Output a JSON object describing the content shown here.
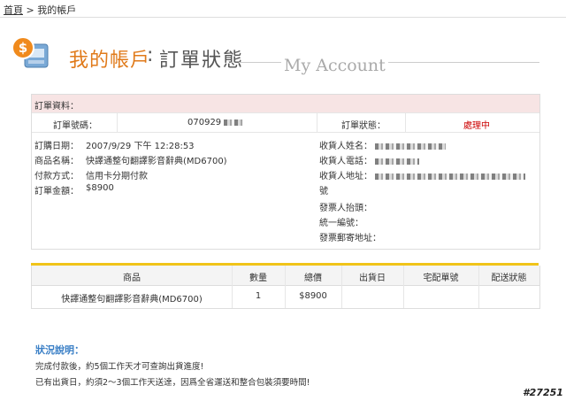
{
  "breadcrumb": {
    "home": "首頁",
    "sep": ">",
    "current": "我的帳戶"
  },
  "header": {
    "title": "我的帳戶",
    "colon": ":",
    "subtitle": "訂單狀態",
    "english": "My Account"
  },
  "order": {
    "section_title": "訂單資料：",
    "order_no_label": "訂單號碼：",
    "order_no_value": "070929",
    "status_label": "訂單狀態：",
    "status_value": "處理中",
    "date_label": "訂購日期：",
    "date_value": "2007/9/29 下午 12:28:53",
    "product_label": "商品名稱：",
    "product_value": "快譯通整句翻譯影音辭典(MD6700)",
    "payment_label": "付款方式：",
    "payment_value": "信用卡分期付款",
    "amount_label": "訂單金額：",
    "amount_value": "$8900",
    "recipient_name_label": "收貨人姓名：",
    "recipient_phone_label": "收貨人電話：",
    "recipient_address_label": "收貨人地址：",
    "address_suffix": "號",
    "invoice_title_label": "發票人抬頭：",
    "tax_id_label": "統一編號：",
    "invoice_address_label": "發票郵寄地址："
  },
  "items_table": {
    "headers": [
      "商品",
      "數量",
      "總價",
      "出貨日",
      "宅配單號",
      "配送狀態"
    ],
    "rows": [
      {
        "product": "快譯通整句翻譯影音辭典(MD6700)",
        "qty": "1",
        "total": "$8900",
        "ship_date": "",
        "tracking": "",
        "delivery_status": ""
      }
    ]
  },
  "notes": {
    "title": "狀況說明：",
    "line1": "完成付款後，約5個工作天才可查詢出貨進度!",
    "line2": "已有出貨日，約須2～3個工作天送達，因爲全省運送和整合包裝須要時間!"
  },
  "watermark": "#27251",
  "colors": {
    "brand_orange": "#e07a1a",
    "status_red": "#cc0000",
    "gold_bar": "#f0c419",
    "note_blue": "#3a7fc6",
    "section_pink": "#f7e4e4"
  }
}
